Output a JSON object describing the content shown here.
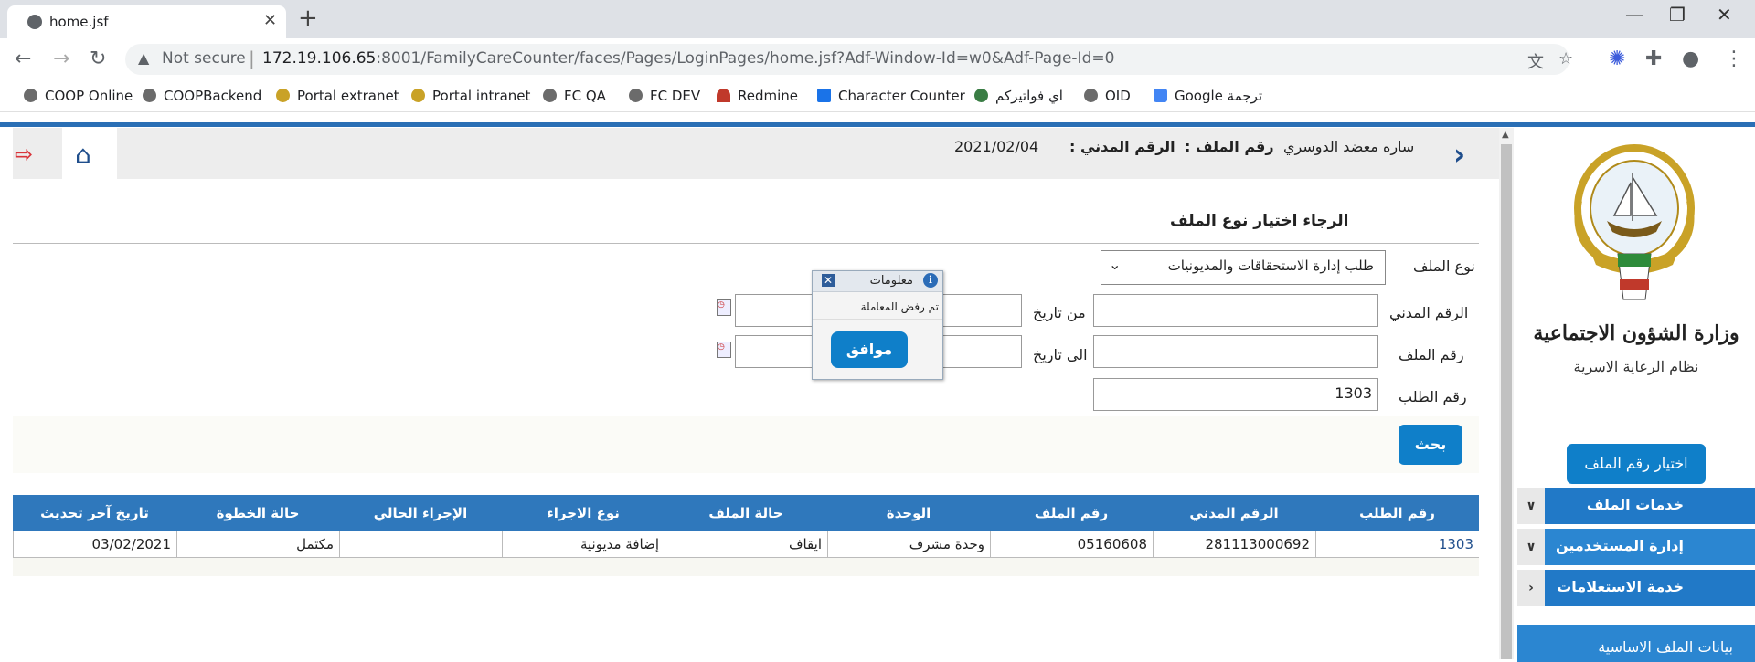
{
  "browser": {
    "tab_title": "home.jsf",
    "not_secure": "Not secure",
    "url_host": "172.19.106.65",
    "url_rest": ":8001/FamilyCareCounter/faces/Pages/LoginPages/home.jsf?Adf-Window-Id=w0&Adf-Page-Id=0",
    "bookmarks": [
      "COOP Online",
      "COOPBackend",
      "Portal extranet",
      "Portal intranet",
      "FC QA",
      "FC DEV",
      "Redmine",
      "Character Counter",
      "اي فواتيركم",
      "OID",
      "Google ترجمة"
    ]
  },
  "header": {
    "user_name": "ساره معضد الدوسري",
    "file_no_label": "رقم الملف :",
    "civil_no_label": "الرقم المدني :",
    "date": "2021/02/04"
  },
  "sidebar": {
    "ministry": "وزارة الشؤون الاجتماعية",
    "system": "نظام الرعاية الاسرية",
    "choose_file_button": "اختيار رقم الملف",
    "menu": [
      "خدمات الملف",
      "إدارة المستخدمين",
      "خدمة الاستعلامات"
    ],
    "basic_data": "بيانات الملف الاساسية"
  },
  "form": {
    "title": "الرجاء اختيار نوع الملف",
    "file_type_label": "نوع الملف",
    "file_type_value": "طلب إدارة الاستحقاقات والمديونيات",
    "civil_no_label": "الرقم المدني",
    "from_date_label": "من تاريخ",
    "file_no_label": "رقم الملف",
    "to_date_label": "الى تاريخ",
    "request_no_label": "رقم الطلب",
    "request_no_value": "1303",
    "search_button": "بحث"
  },
  "table": {
    "headers": [
      "رقم الطلب",
      "الرقم المدني",
      "رقم الملف",
      "الوحدة",
      "حالة الملف",
      "نوع الاجراء",
      "الإجراء الحالي",
      "حالة الخطوة",
      "تاريخ آخر تحديث"
    ],
    "rows": [
      [
        "1303",
        "281113000692",
        "05160608",
        "وحدة مشرف",
        "ايقاف",
        "إضافة مديونية",
        "",
        "مكتمل",
        "03/02/2021"
      ]
    ]
  },
  "popup": {
    "title": "معلومات",
    "message": "تم رفض المعاملة",
    "ok_button": "موافق"
  },
  "colors": {
    "accent": "#0f7fc9",
    "table_header": "#2f78bc",
    "menu": "#2179c7"
  }
}
